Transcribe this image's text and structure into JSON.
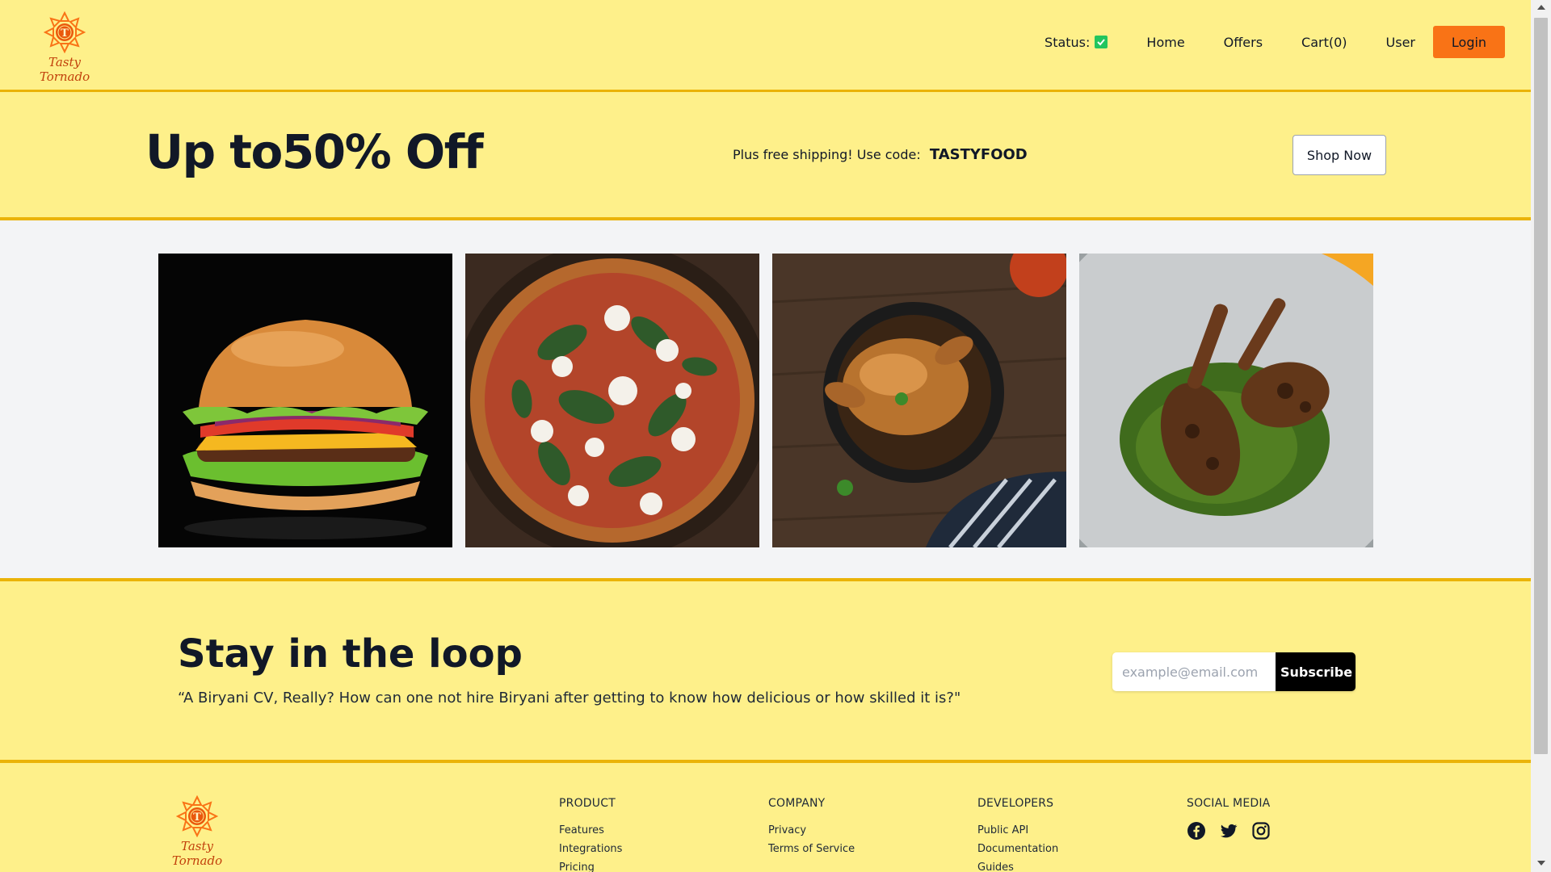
{
  "header": {
    "brand": "Tasty Tornado",
    "nav": {
      "status_label": "Status:",
      "home": "Home",
      "offers": "Offers",
      "cart": "Cart(0)",
      "user": "User",
      "login": "Login"
    }
  },
  "promo": {
    "title": "Up to50% Off",
    "text": "Plus free shipping! Use code:",
    "code": "TASTYFOOD",
    "cta": "Shop Now"
  },
  "gallery": {
    "items": [
      "burger",
      "pizza",
      "roast-chicken",
      "grilled-chicken-legs"
    ]
  },
  "newsletter": {
    "title": "Stay in the loop",
    "quote": "“A Biryani CV, Really? How can one not hire Biryani after getting to know how delicious or how skilled it is?\"",
    "placeholder": "example@email.com",
    "button": "Subscribe"
  },
  "footer": {
    "brand": "Tasty Tornado",
    "columns": [
      {
        "title": "PRODUCT",
        "links": [
          "Features",
          "Integrations",
          "Pricing"
        ]
      },
      {
        "title": "COMPANY",
        "links": [
          "Privacy",
          "Terms of Service"
        ]
      },
      {
        "title": "DEVELOPERS",
        "links": [
          "Public API",
          "Documentation",
          "Guides"
        ]
      },
      {
        "title": "SOCIAL MEDIA",
        "icons": [
          "facebook-icon",
          "twitter-icon",
          "instagram-icon"
        ]
      }
    ]
  },
  "colors": {
    "background": "#fef08a",
    "border": "#eab308",
    "accent": "#f97316",
    "status_ok": "#22c55e"
  }
}
